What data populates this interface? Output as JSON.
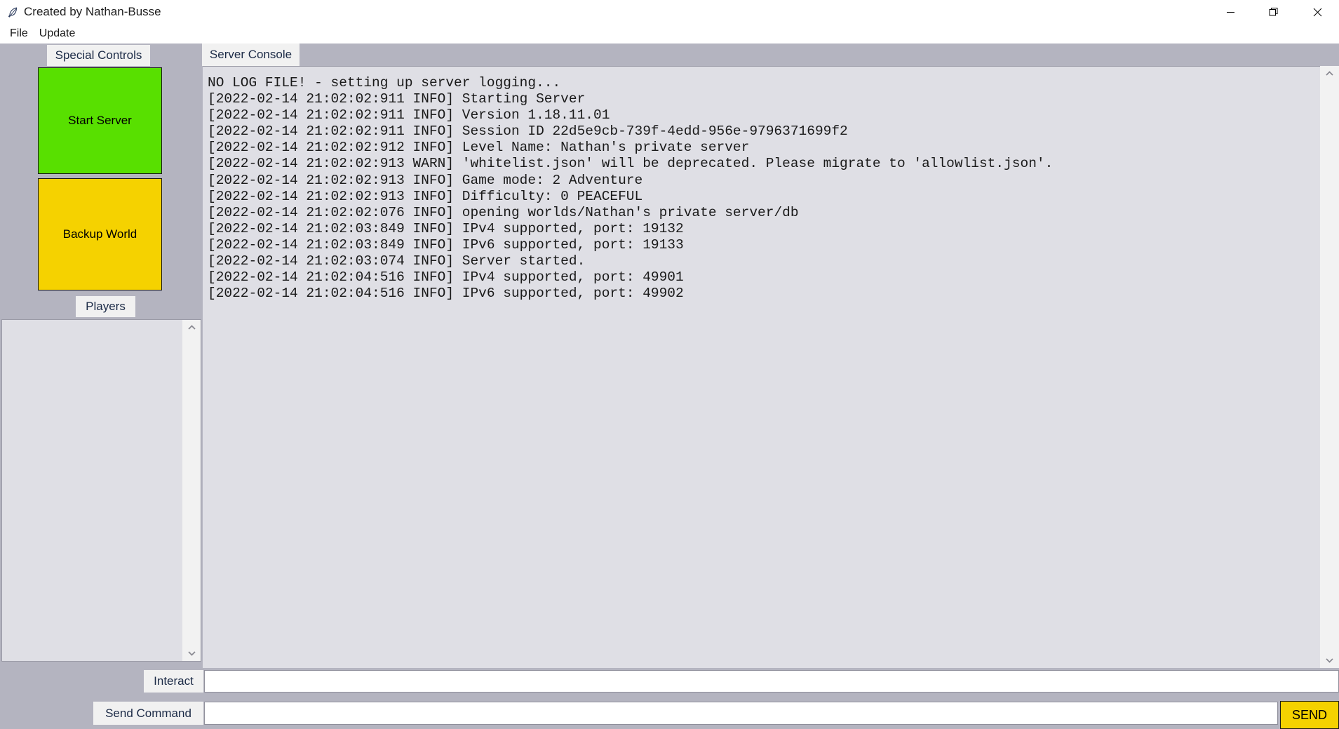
{
  "window": {
    "title": "Created by Nathan-Busse",
    "icon": "quill-feather-icon",
    "controls": {
      "minimize": "minimize-icon",
      "maximize": "restore-icon",
      "close": "close-icon"
    }
  },
  "menubar": {
    "items": [
      {
        "label": "File"
      },
      {
        "label": "Update"
      }
    ]
  },
  "left_panel": {
    "special_controls_tab": "Special Controls",
    "buttons": [
      {
        "label": "Start Server",
        "color": "#58e000"
      },
      {
        "label": "Backup World",
        "color": "#f5d200"
      }
    ],
    "players_tab": "Players",
    "players": []
  },
  "right_panel": {
    "console_tab": "Server Console",
    "console_lines": [
      "NO LOG FILE! - setting up server logging...",
      "[2022-02-14 21:02:02:911 INFO] Starting Server",
      "[2022-02-14 21:02:02:911 INFO] Version 1.18.11.01",
      "[2022-02-14 21:02:02:911 INFO] Session ID 22d5e9cb-739f-4edd-956e-9796371699f2",
      "[2022-02-14 21:02:02:912 INFO] Level Name: Nathan's private server",
      "[2022-02-14 21:02:02:913 WARN] 'whitelist.json' will be deprecated. Please migrate to 'allowlist.json'.",
      "[2022-02-14 21:02:02:913 INFO] Game mode: 2 Adventure",
      "[2022-02-14 21:02:02:913 INFO] Difficulty: 0 PEACEFUL",
      "[2022-02-14 21:02:02:076 INFO] opening worlds/Nathan's private server/db",
      "[2022-02-14 21:02:03:849 INFO] IPv4 supported, port: 19132",
      "[2022-02-14 21:02:03:849 INFO] IPv6 supported, port: 19133",
      "[2022-02-14 21:02:03:074 INFO] Server started.",
      "[2022-02-14 21:02:04:516 INFO] IPv4 supported, port: 49901",
      "[2022-02-14 21:02:04:516 INFO] IPv6 supported, port: 49902"
    ]
  },
  "bottom": {
    "interact_label": "Interact",
    "interact_value": "",
    "interact_placeholder": "",
    "send_command_label": "Send Command",
    "command_value": "",
    "command_placeholder": "",
    "send_button": "SEND"
  },
  "colors": {
    "window_bg": "#b4b4c0",
    "panel_bg": "#dfdfe5",
    "tab_bg": "#f1f1f1",
    "start_green": "#58e000",
    "backup_yellow": "#f5d200",
    "send_yellow": "#f5d200"
  }
}
